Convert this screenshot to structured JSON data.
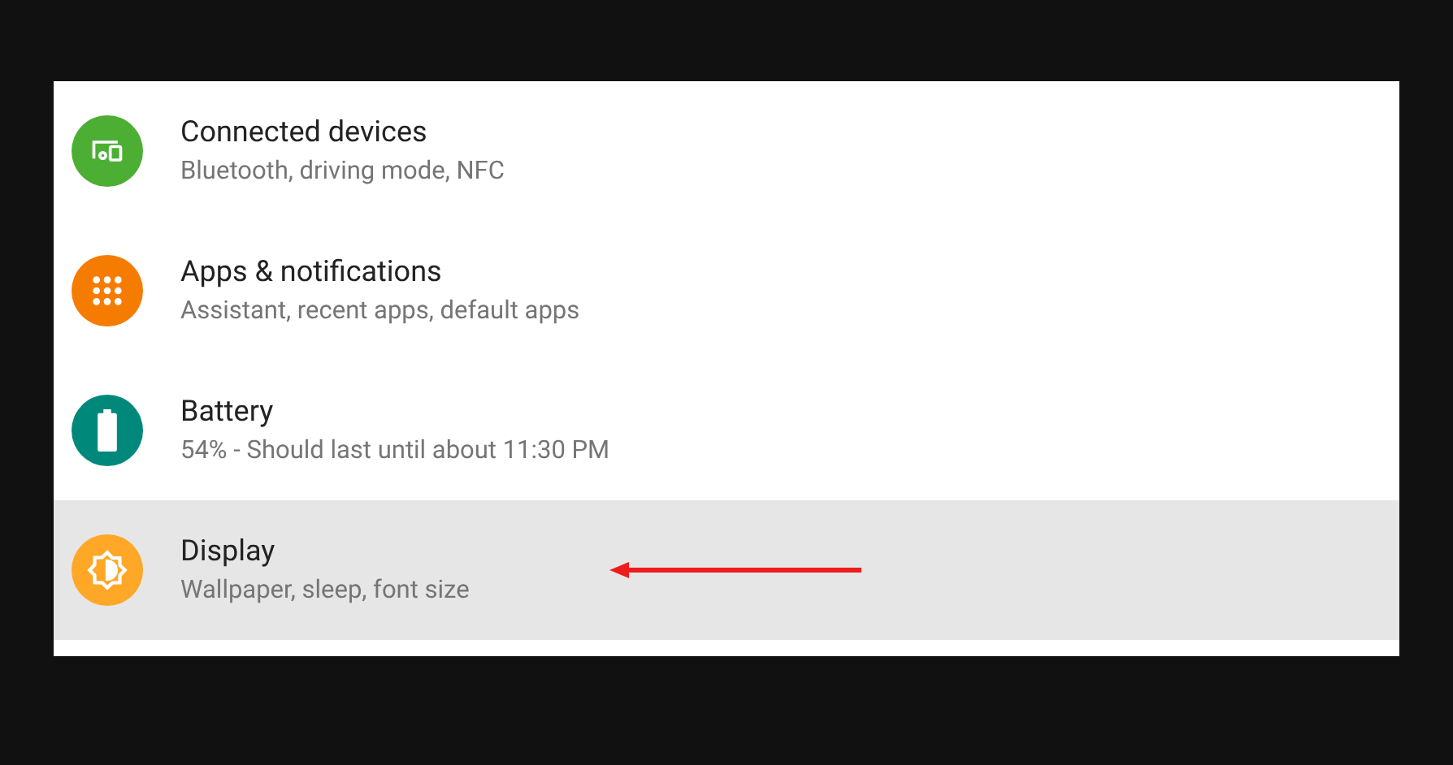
{
  "settings": [
    {
      "kind": "devices",
      "color": "#4caf34",
      "title": "Connected devices",
      "subtitle": "Bluetooth, driving mode, NFC",
      "selected": false
    },
    {
      "kind": "apps",
      "color": "#f57c00",
      "title": "Apps & notifications",
      "subtitle": "Assistant, recent apps, default apps",
      "selected": false
    },
    {
      "kind": "battery",
      "color": "#00897b",
      "title": "Battery",
      "subtitle": "54% - Should last until about 11:30 PM",
      "selected": false
    },
    {
      "kind": "display",
      "color": "#ffa726",
      "title": "Display",
      "subtitle": "Wallpaper, sleep, font size",
      "selected": true
    }
  ]
}
